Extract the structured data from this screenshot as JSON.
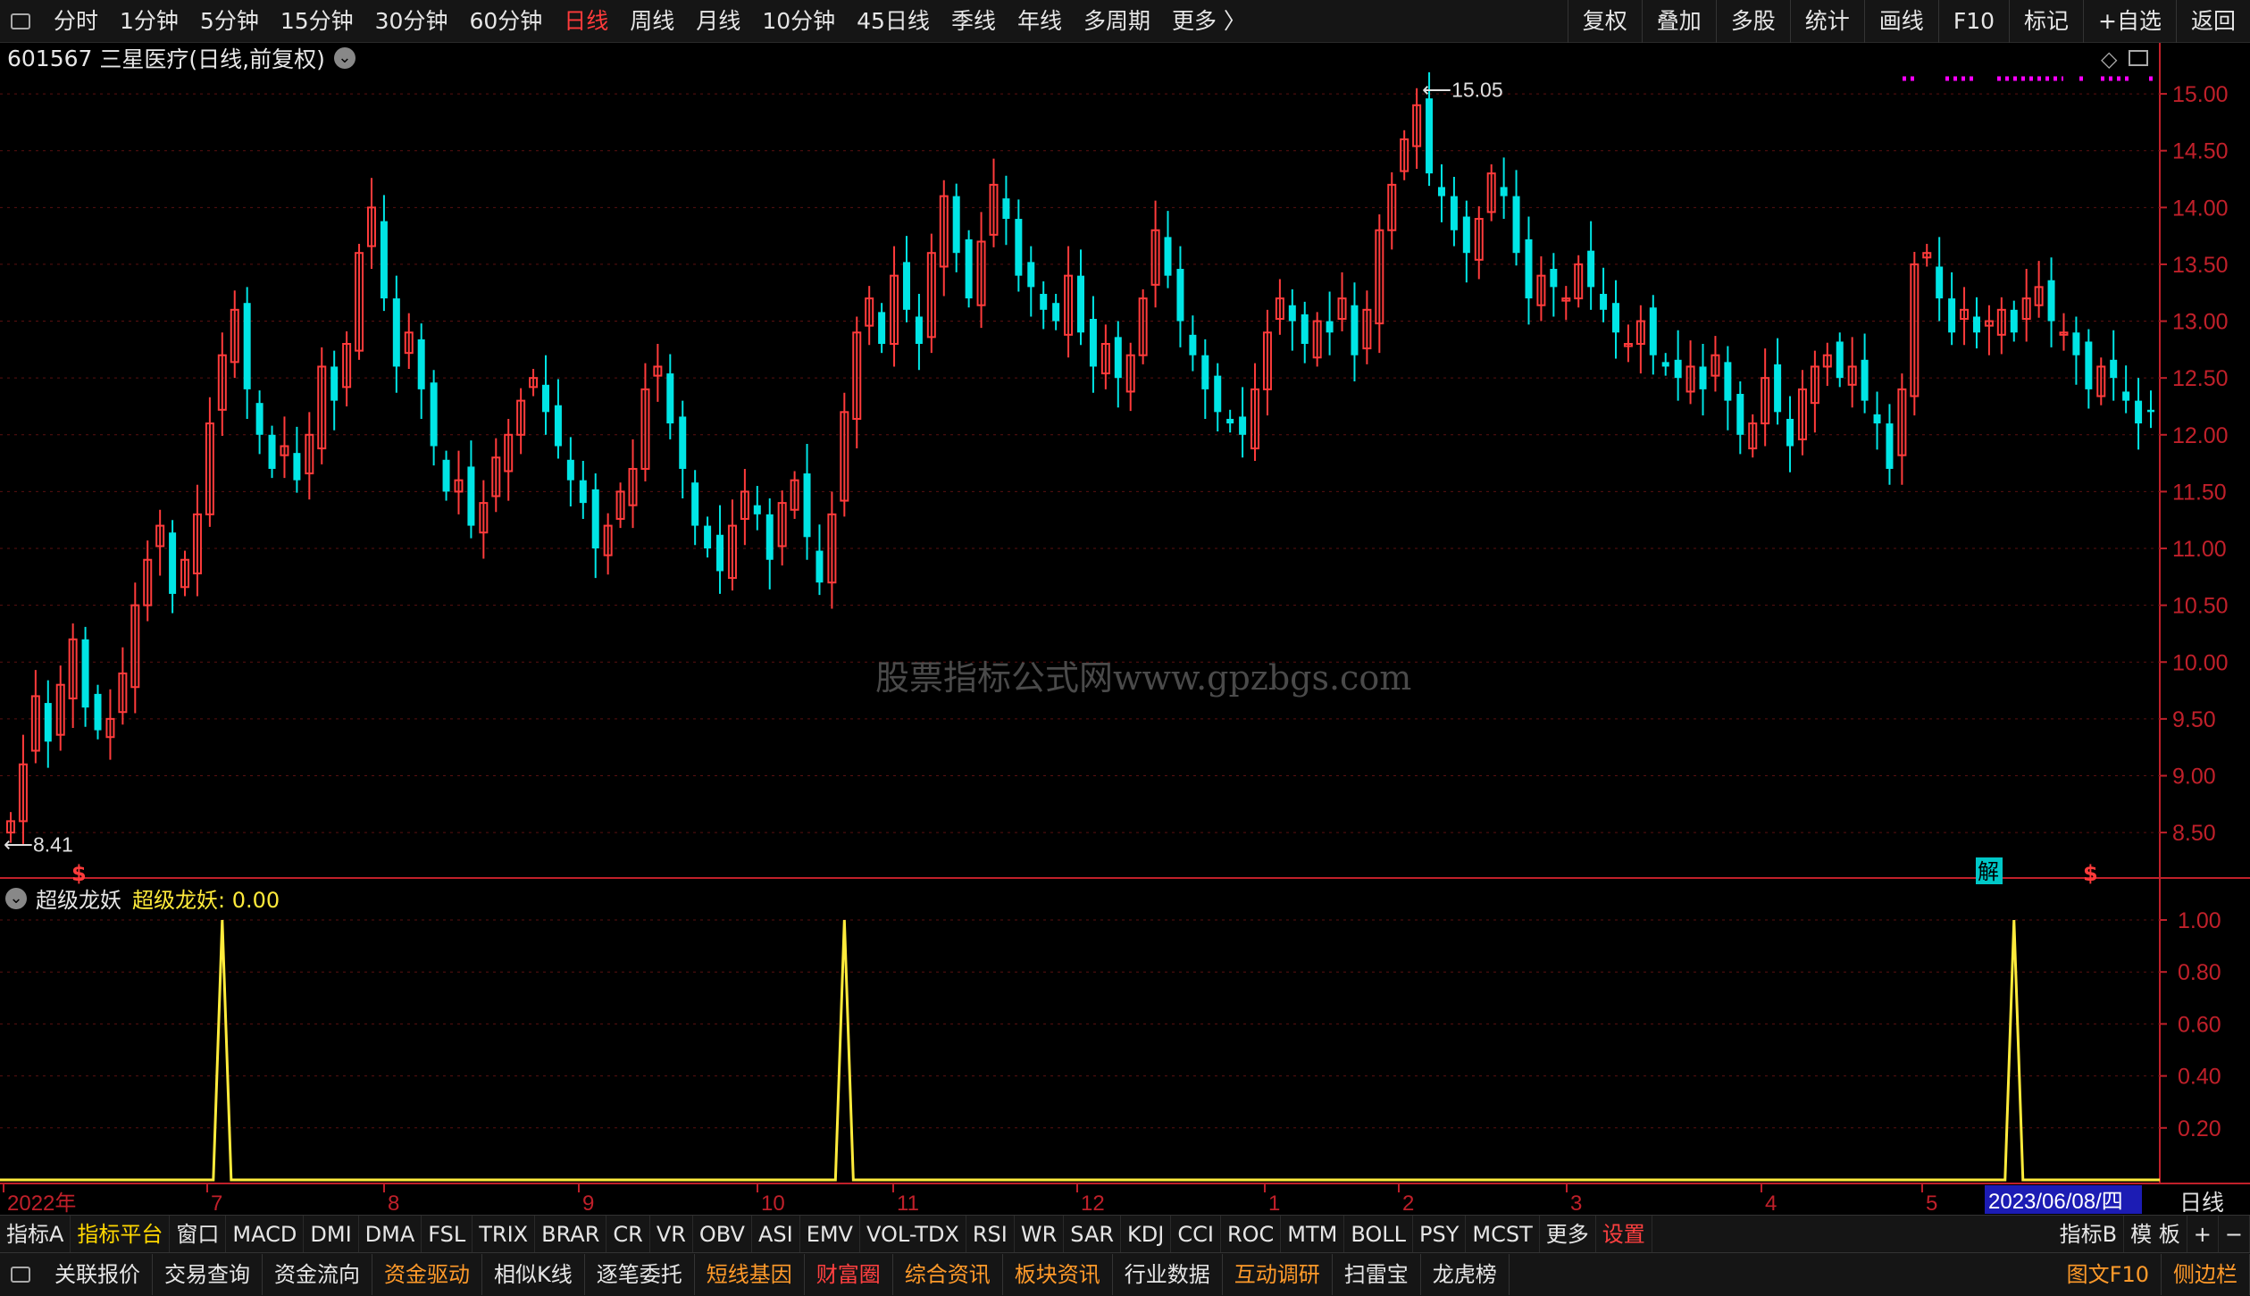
{
  "topbar": {
    "tabs": [
      "分时",
      "1分钟",
      "5分钟",
      "15分钟",
      "30分钟",
      "60分钟",
      "日线",
      "周线",
      "月线",
      "10分钟",
      "45日线",
      "季线",
      "年线",
      "多周期",
      "更多 〉"
    ],
    "active": "日线",
    "right_tabs": [
      "复权",
      "叠加",
      "多股",
      "统计",
      "画线",
      "F10",
      "标记",
      "+自选",
      "返回"
    ]
  },
  "stock": {
    "code": "601567",
    "name": "三星医疗",
    "mode": "(日线,前复权)"
  },
  "colors": {
    "up": "#ff3b3b",
    "down": "#00e5e5",
    "axis": "#c0202a",
    "indicator_line": "#ffeb3b",
    "magenta": "#ff00ff"
  },
  "chart_data": {
    "type": "candlestick",
    "price_ticks": [
      "15.00",
      "14.50",
      "14.00",
      "13.50",
      "13.00",
      "12.50",
      "12.00",
      "11.50",
      "11.00",
      "10.50",
      "10.00",
      "9.50",
      "9.00",
      "8.50"
    ],
    "price_range": [
      8.1,
      15.15
    ],
    "high_label": "15.05",
    "low_label": "8.41",
    "month_labels": [
      "2022年",
      "7",
      "8",
      "9",
      "10",
      "11",
      "12",
      "1",
      "2",
      "3",
      "4",
      "5"
    ],
    "date_readout": "2023/06/08/四",
    "period_label": "日线",
    "badges": [
      "$",
      "解",
      "$"
    ],
    "closes": [
      8.6,
      9.1,
      9.7,
      9.3,
      9.8,
      10.2,
      9.6,
      9.4,
      9.5,
      9.9,
      10.5,
      10.9,
      11.2,
      10.6,
      10.9,
      11.3,
      12.1,
      12.7,
      13.1,
      12.4,
      12.0,
      11.7,
      11.9,
      11.6,
      12.0,
      12.6,
      12.3,
      12.8,
      13.6,
      14.0,
      13.2,
      12.6,
      12.9,
      12.4,
      11.9,
      11.5,
      11.6,
      11.2,
      11.4,
      11.8,
      12.0,
      12.3,
      12.5,
      12.2,
      11.9,
      11.6,
      11.4,
      11.0,
      11.2,
      11.5,
      11.7,
      12.4,
      12.6,
      12.1,
      11.7,
      11.2,
      11.0,
      10.8,
      11.2,
      11.5,
      11.3,
      10.9,
      11.4,
      11.6,
      11.1,
      10.7,
      11.3,
      12.2,
      12.9,
      13.2,
      12.8,
      13.4,
      13.1,
      12.8,
      13.6,
      14.1,
      13.6,
      13.2,
      13.7,
      14.2,
      13.9,
      13.4,
      13.3,
      13.1,
      13.0,
      13.4,
      12.9,
      12.6,
      12.8,
      12.5,
      12.7,
      13.2,
      13.8,
      13.4,
      13.0,
      12.7,
      12.4,
      12.2,
      12.1,
      12.0,
      12.4,
      12.9,
      13.2,
      13.0,
      12.8,
      13.0,
      12.9,
      13.2,
      12.7,
      13.1,
      13.8,
      14.2,
      14.6,
      14.9,
      14.3,
      14.1,
      13.8,
      13.6,
      13.9,
      14.3,
      14.1,
      13.6,
      13.2,
      13.4,
      13.3,
      13.2,
      13.5,
      13.3,
      13.1,
      12.9,
      12.8,
      13.0,
      12.7,
      12.6,
      12.5,
      12.6,
      12.4,
      12.7,
      12.3,
      12.0,
      12.1,
      12.5,
      12.2,
      11.9,
      12.4,
      12.6,
      12.7,
      12.5,
      12.6,
      12.3,
      12.1,
      11.7,
      12.4,
      13.5,
      13.6,
      13.2,
      12.9,
      13.1,
      12.9,
      13.0,
      13.1,
      12.9,
      13.2,
      13.3,
      13.0,
      12.9,
      12.7,
      12.4,
      12.6,
      12.5,
      12.3,
      12.1,
      12.2
    ],
    "indicator": {
      "name": "超级龙妖",
      "value_label": "超级龙妖: 0.00",
      "ticks": [
        "1.00",
        "0.80",
        "0.60",
        "0.40",
        "0.20"
      ],
      "spike_candle_indices": [
        17,
        67,
        161
      ]
    }
  },
  "indicator_bar": {
    "items": [
      "指标A",
      "指标平台",
      "窗口",
      "MACD",
      "DMI",
      "DMA",
      "FSL",
      "TRIX",
      "BRAR",
      "CR",
      "VR",
      "OBV",
      "ASI",
      "EMV",
      "VOL-TDX",
      "RSI",
      "WR",
      "SAR",
      "KDJ",
      "CCI",
      "ROC",
      "MTM",
      "BOLL",
      "PSY",
      "MCST",
      "更多",
      "设置"
    ],
    "highlight": "指标平台",
    "settings": "设置",
    "right": [
      "指标B",
      "模 板",
      "+",
      "−"
    ]
  },
  "bottom_bar": {
    "items": [
      {
        "label": "关联报价",
        "color": "white"
      },
      {
        "label": "交易查询",
        "color": "white"
      },
      {
        "label": "资金流向",
        "color": "white"
      },
      {
        "label": "资金驱动",
        "color": "orange"
      },
      {
        "label": "相似K线",
        "color": "white"
      },
      {
        "label": "逐笔委托",
        "color": "white"
      },
      {
        "label": "短线基因",
        "color": "orange"
      },
      {
        "label": "财富圈",
        "color": "red"
      },
      {
        "label": "综合资讯",
        "color": "orange"
      },
      {
        "label": "板块资讯",
        "color": "orange"
      },
      {
        "label": "行业数据",
        "color": "white"
      },
      {
        "label": "互动调研",
        "color": "orange"
      },
      {
        "label": "扫雷宝",
        "color": "white"
      },
      {
        "label": "龙虎榜",
        "color": "white"
      }
    ],
    "right": [
      {
        "label": "图文F10",
        "color": "orange"
      },
      {
        "label": "侧边栏",
        "color": "orange"
      }
    ]
  },
  "watermark": "股票指标公式网www.gpzbgs.com"
}
